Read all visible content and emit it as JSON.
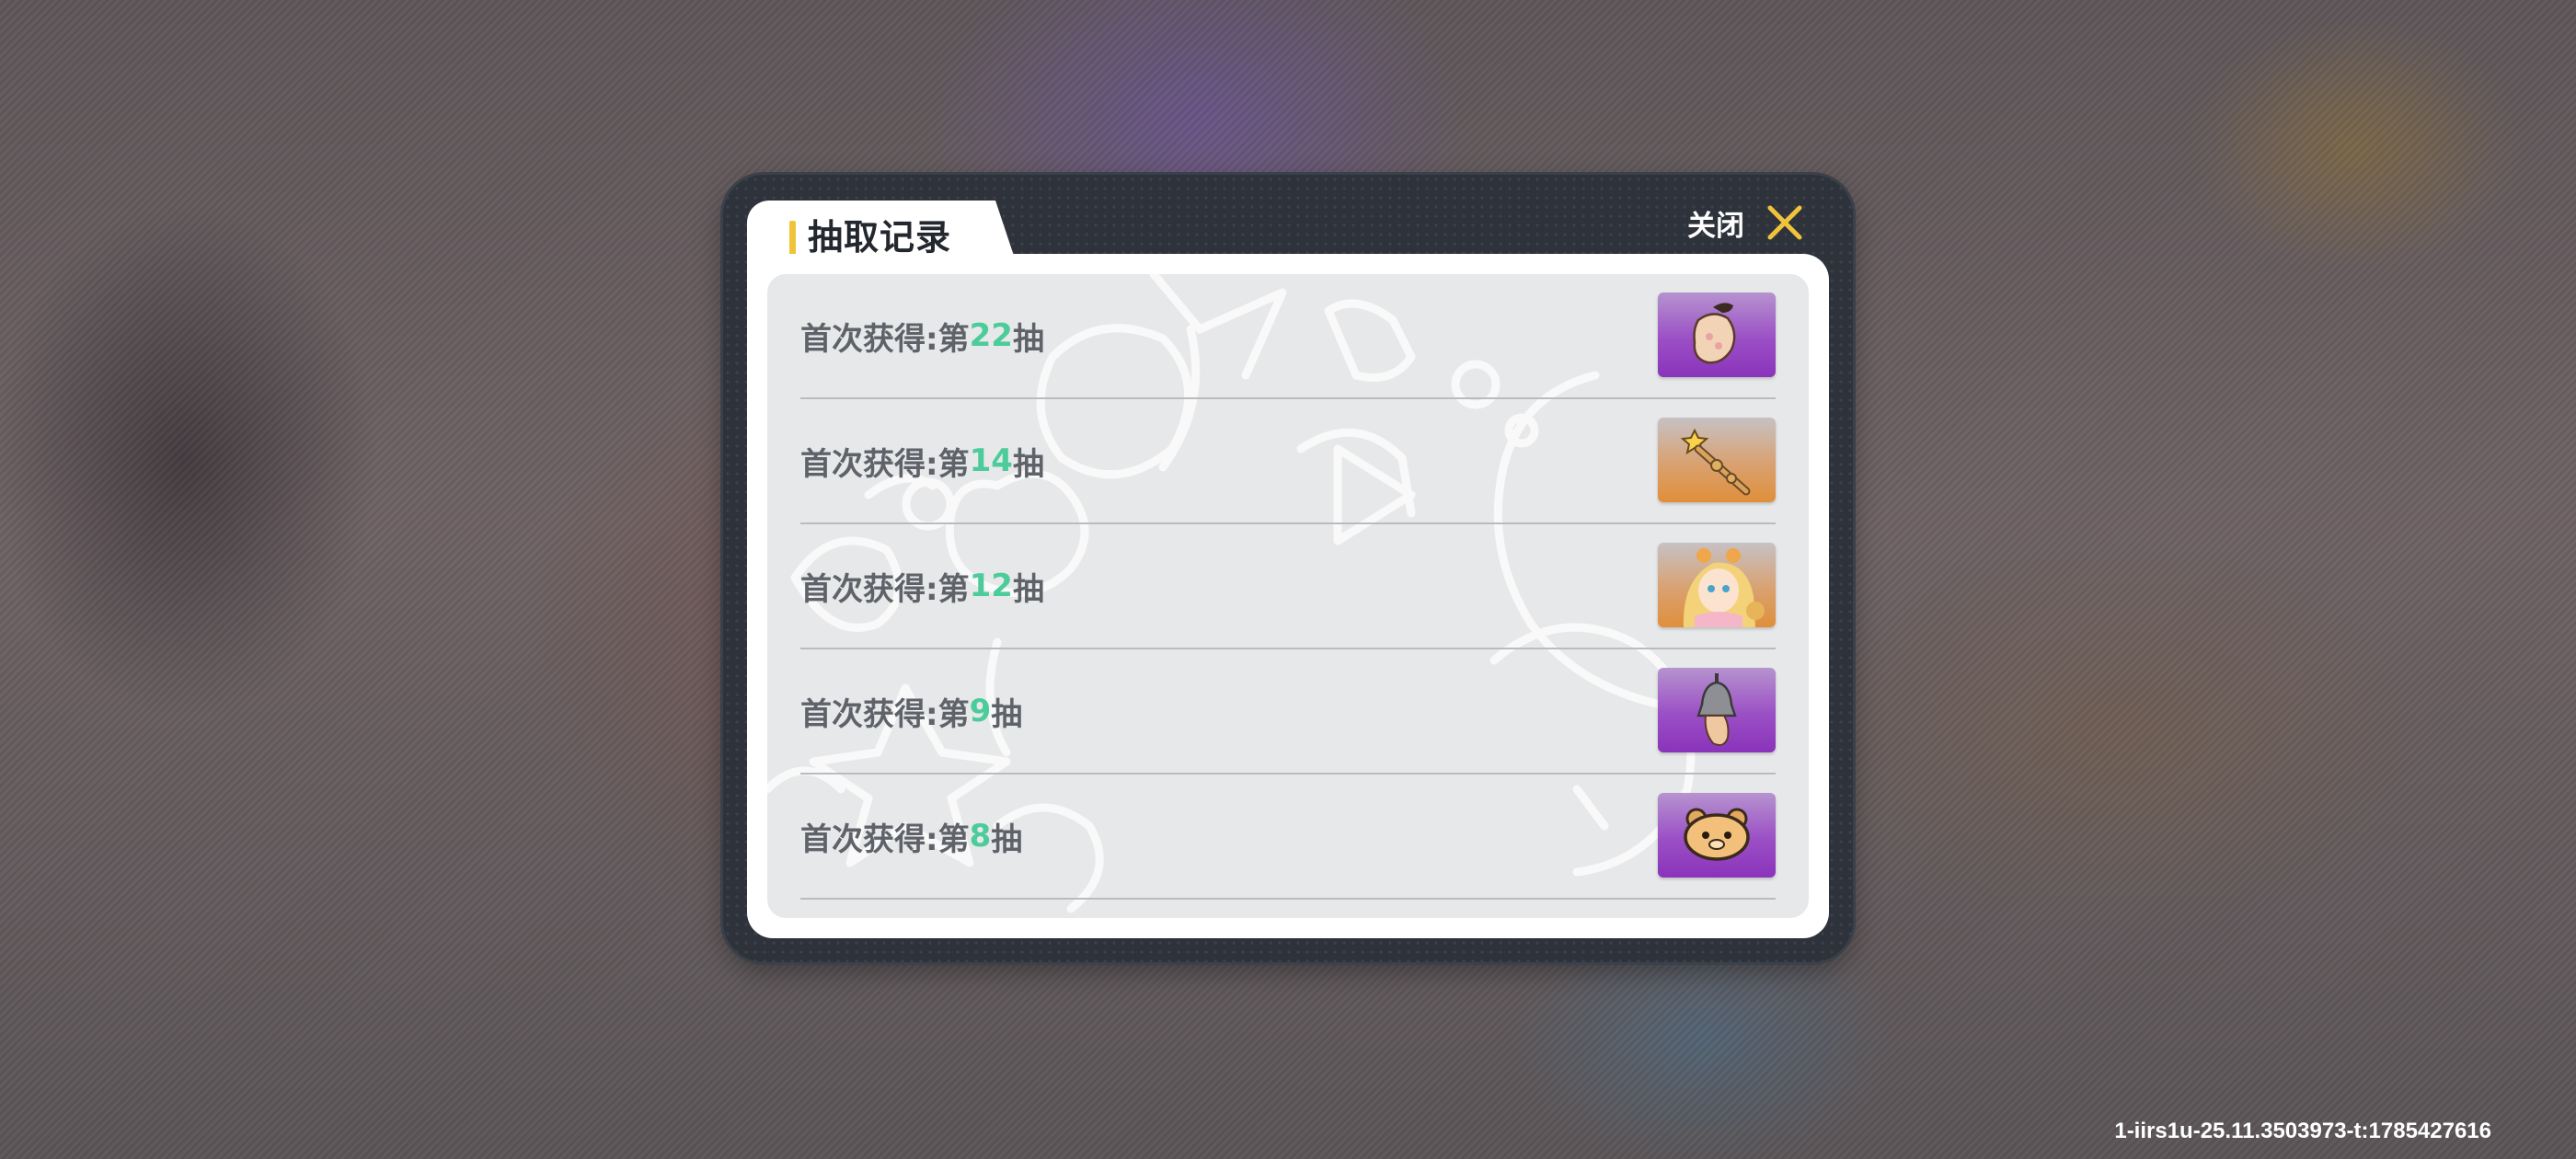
{
  "dialog": {
    "title": "抽取记录",
    "close_label": "关闭"
  },
  "records": [
    {
      "prefix": "首次获得:第",
      "number": "22",
      "suffix": "抽",
      "icon": "cat-paw-icon",
      "rarity": "purple"
    },
    {
      "prefix": "首次获得:第",
      "number": "14",
      "suffix": "抽",
      "icon": "star-wand-icon",
      "rarity": "orange"
    },
    {
      "prefix": "首次获得:第",
      "number": "12",
      "suffix": "抽",
      "icon": "character-portrait-icon",
      "rarity": "orange"
    },
    {
      "prefix": "首次获得:第",
      "number": "9",
      "suffix": "抽",
      "icon": "bell-lamp-icon",
      "rarity": "purple"
    },
    {
      "prefix": "首次获得:第",
      "number": "8",
      "suffix": "抽",
      "icon": "bear-face-icon",
      "rarity": "purple"
    }
  ],
  "footer": {
    "build_id": "1-iirs1u-25.11.3503973-t:1785427616"
  },
  "colors": {
    "accent": "#f0c43a",
    "number": "#4ccc9a",
    "purple_rarity": "#9b4fc5",
    "orange_rarity": "#e08f3a"
  }
}
